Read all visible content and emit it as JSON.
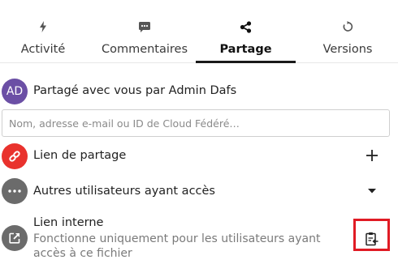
{
  "tabs": [
    {
      "label": "Activité",
      "icon": "activity-bolt-icon",
      "active": false
    },
    {
      "label": "Commentaires",
      "icon": "comment-icon",
      "active": false
    },
    {
      "label": "Partage",
      "icon": "share-icon",
      "active": true
    },
    {
      "label": "Versions",
      "icon": "history-icon",
      "active": false
    }
  ],
  "shared_by": {
    "avatar_initials": "AD",
    "avatar_color": "#6b4fa5",
    "text": "Partagé avec vous par Admin Dafs"
  },
  "search": {
    "placeholder": "Nom, adresse e-mail ou ID de Cloud Fédéré…",
    "value": ""
  },
  "share_link": {
    "label": "Lien de partage",
    "icon": "link-icon",
    "icon_bg": "#e9322d",
    "action_icon": "plus-icon"
  },
  "other_users": {
    "label": "Autres utilisateurs ayant accès",
    "icon": "more-dots-icon",
    "icon_bg": "#6b6b6b",
    "action_icon": "caret-down-icon"
  },
  "internal_link": {
    "label": "Lien interne",
    "description": "Fonctionne uniquement pour les utilisateurs ayant accès à ce fichier",
    "icon": "external-link-icon",
    "icon_bg": "#6b6b6b",
    "action_icon": "clipboard-icon"
  },
  "colors": {
    "highlight": "#e01b24",
    "active_tab": "#1a1a1a"
  }
}
